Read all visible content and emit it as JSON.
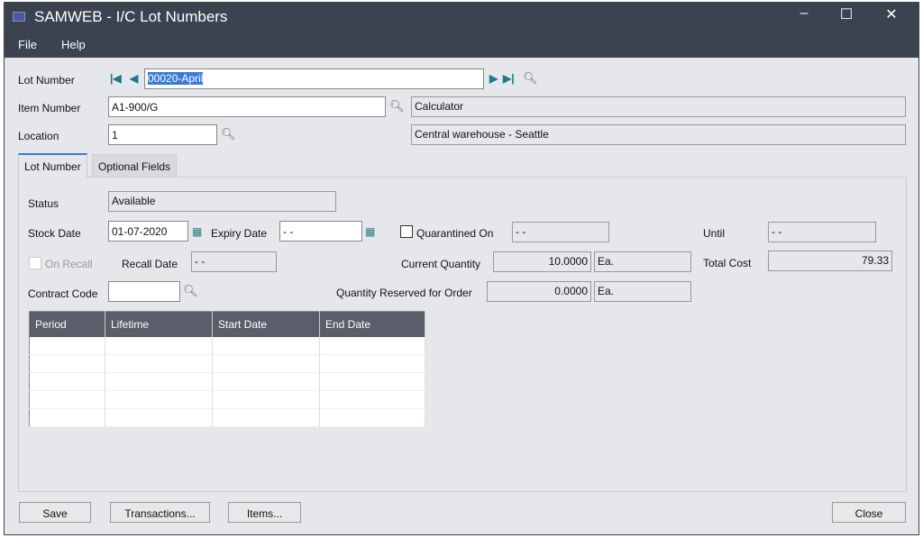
{
  "window": {
    "title": "SAMWEB - I/C Lot Numbers",
    "minimize": "–",
    "maximize": "☐",
    "close": "✕"
  },
  "menu": {
    "file": "File",
    "help": "Help"
  },
  "header": {
    "lot_label": "Lot Number",
    "lot_value": "00020-April",
    "item_label": "Item Number",
    "item_value": "A1-900/G",
    "item_desc": "Calculator",
    "location_label": "Location",
    "location_value": "1",
    "location_desc": "Central warehouse - Seattle"
  },
  "tabs": [
    {
      "label": "Lot Number",
      "active": true
    },
    {
      "label": "Optional Fields",
      "active": false
    }
  ],
  "lot": {
    "status_label": "Status",
    "status_value": "Available",
    "stock_date_label": "Stock Date",
    "stock_date_value": "01-07-2020",
    "expiry_date_label": "Expiry Date",
    "expiry_date_value": "- -",
    "quarantined_label": "Quarantined On",
    "quarantined_value": "- -",
    "until_label": "Until",
    "until_value": "- -",
    "on_recall_label": "On Recall",
    "recall_date_label": "Recall Date",
    "recall_date_value": "- -",
    "current_qty_label": "Current Quantity",
    "current_qty_value": "10.0000",
    "current_qty_uom": "Ea.",
    "total_cost_label": "Total Cost",
    "total_cost_value": "79.33",
    "contract_code_label": "Contract Code",
    "contract_code_value": "",
    "qty_reserved_label": "Quantity Reserved for Order",
    "qty_reserved_value": "0.0000",
    "qty_reserved_uom": "Ea."
  },
  "table": {
    "columns": [
      "Period",
      "Lifetime",
      "Start Date",
      "End Date"
    ],
    "rows": []
  },
  "buttons": {
    "save": "Save",
    "transactions": "Transactions...",
    "items": "Items...",
    "close": "Close"
  },
  "colors": {
    "titlebar": "#3b4250",
    "accent": "#1a7a8a",
    "selection": "#3a7bd5"
  }
}
